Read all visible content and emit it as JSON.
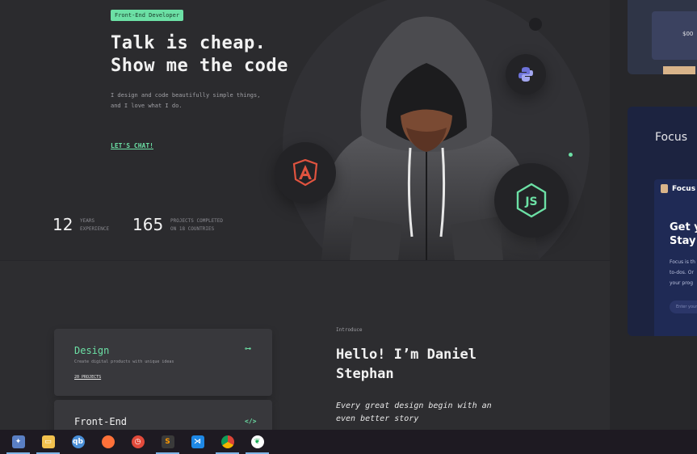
{
  "hero": {
    "badge": "Front-End Developer",
    "headline": "Talk is cheap.\nShow me the code",
    "subline": "I design and code beautifully simple things,\nand I love what I do.",
    "cta": "LET'S CHAT!",
    "stats": [
      {
        "number": "12",
        "label": "YEARS\nEXPERIENCE"
      },
      {
        "number": "165",
        "label": "PROJECTS COMPLETED\nON 18 COUNTRIES"
      }
    ],
    "logos": [
      "angular-icon",
      "python-icon",
      "nodejs-icon"
    ],
    "accent": "#6ce0a5"
  },
  "services": [
    {
      "title": "Design",
      "desc": "Create digital products with unique ideas",
      "link": "20 PROJECTS",
      "icon": "pen-tool-icon"
    },
    {
      "title": "Front-End",
      "icon": "code-icon"
    }
  ],
  "intro": {
    "label": "Introduce",
    "title": "Hello! I’m Daniel\nStephan",
    "quote": "Every great design begin with an\neven better story"
  },
  "side_panel": {
    "top_price": "$00",
    "focus_title": "Focus",
    "brand": "Focus",
    "heading": "Get y\nStay u",
    "body": "Focus is th\nto-dos. Or\nyour prog",
    "input_placeholder": "Enter your"
  },
  "taskbar": {
    "apps": [
      "system-tray-icon",
      "file-explorer-icon",
      "qbittorrent-icon",
      "firefox-icon",
      "clock-app-icon",
      "sublime-text-icon",
      "vscode-icon",
      "chrome-icon",
      "mongodb-compass-icon"
    ]
  }
}
